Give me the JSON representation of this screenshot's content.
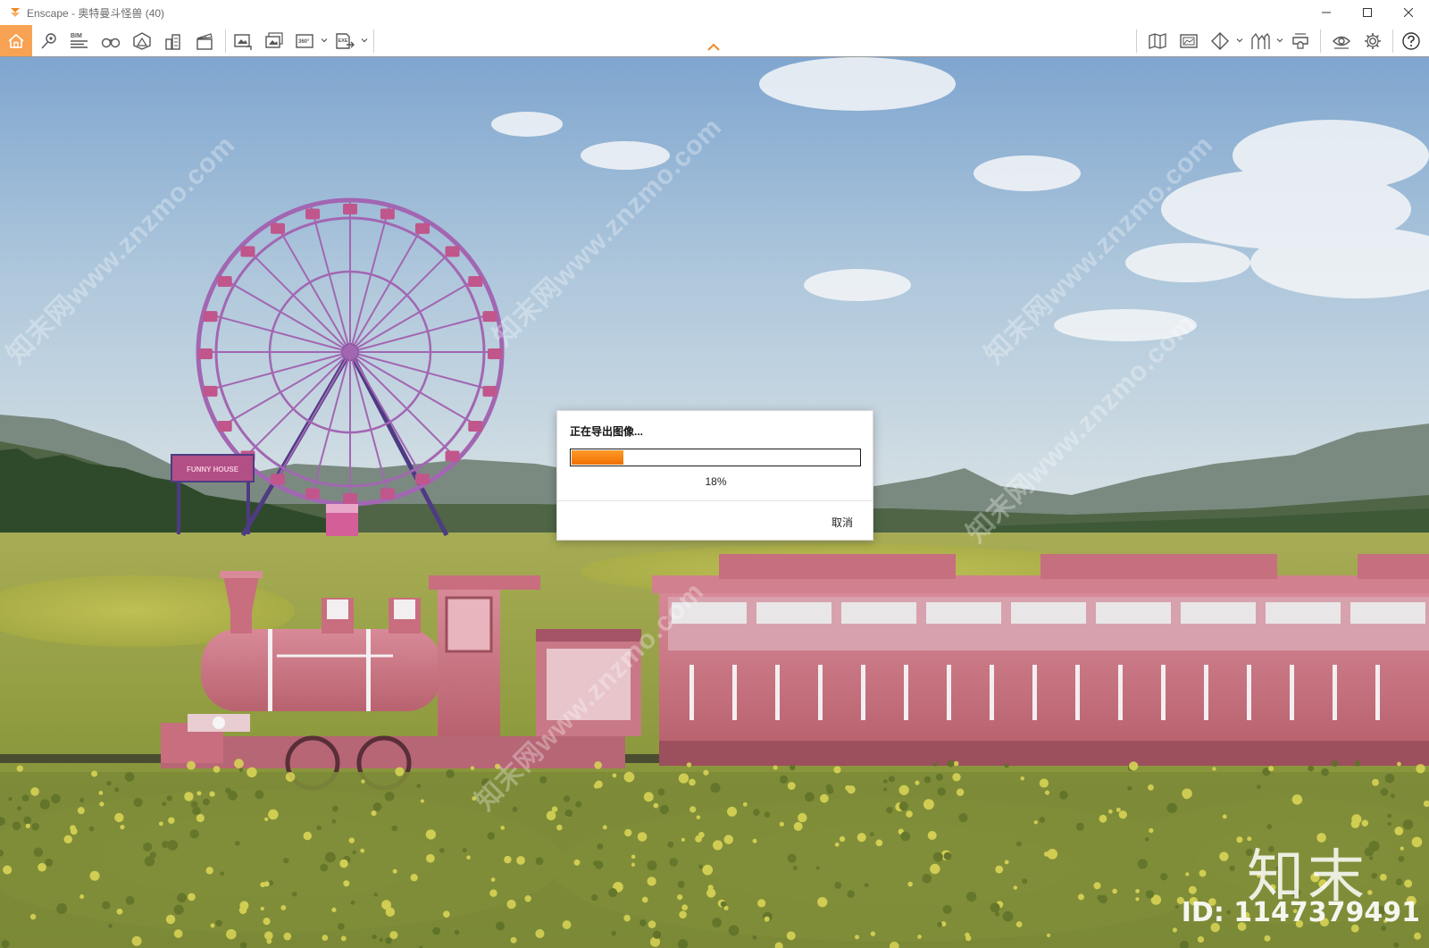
{
  "window": {
    "title": "Enscape - 奥特曼斗怪兽 (40)",
    "controls": [
      "minimize-icon",
      "maximize-icon",
      "close-icon"
    ]
  },
  "toolbar": {
    "left_icons": [
      "home-icon",
      "location-pin-icon",
      "bim-icon",
      "binoculars-icon",
      "asset-library-icon",
      "buildings-icon",
      "video-editor-icon",
      "screenshot-icon",
      "batch-render-icon",
      "panorama-360-icon",
      "export-exe-icon"
    ],
    "bim_label": "BIM",
    "panorama_label": "360°",
    "exe_label": "EXE",
    "right_icons": [
      "map-icon",
      "atmosphere-icon",
      "view-mode-icon",
      "sketch-icon",
      "vr-headset-icon",
      "visual-settings-icon",
      "settings-gear-icon",
      "help-icon"
    ],
    "accent_color": "#F7A353"
  },
  "dialog": {
    "title": "正在导出图像...",
    "progress": 0.18,
    "progress_text": "18%",
    "cancel_label": "取消",
    "progress_color": "#F07000"
  },
  "watermark": {
    "text": "知末网www.znzmo.com",
    "brand": "知末",
    "id_text": "ID: 1147379491"
  },
  "scene": {
    "sign_text": "FUNNY HOUSE"
  }
}
